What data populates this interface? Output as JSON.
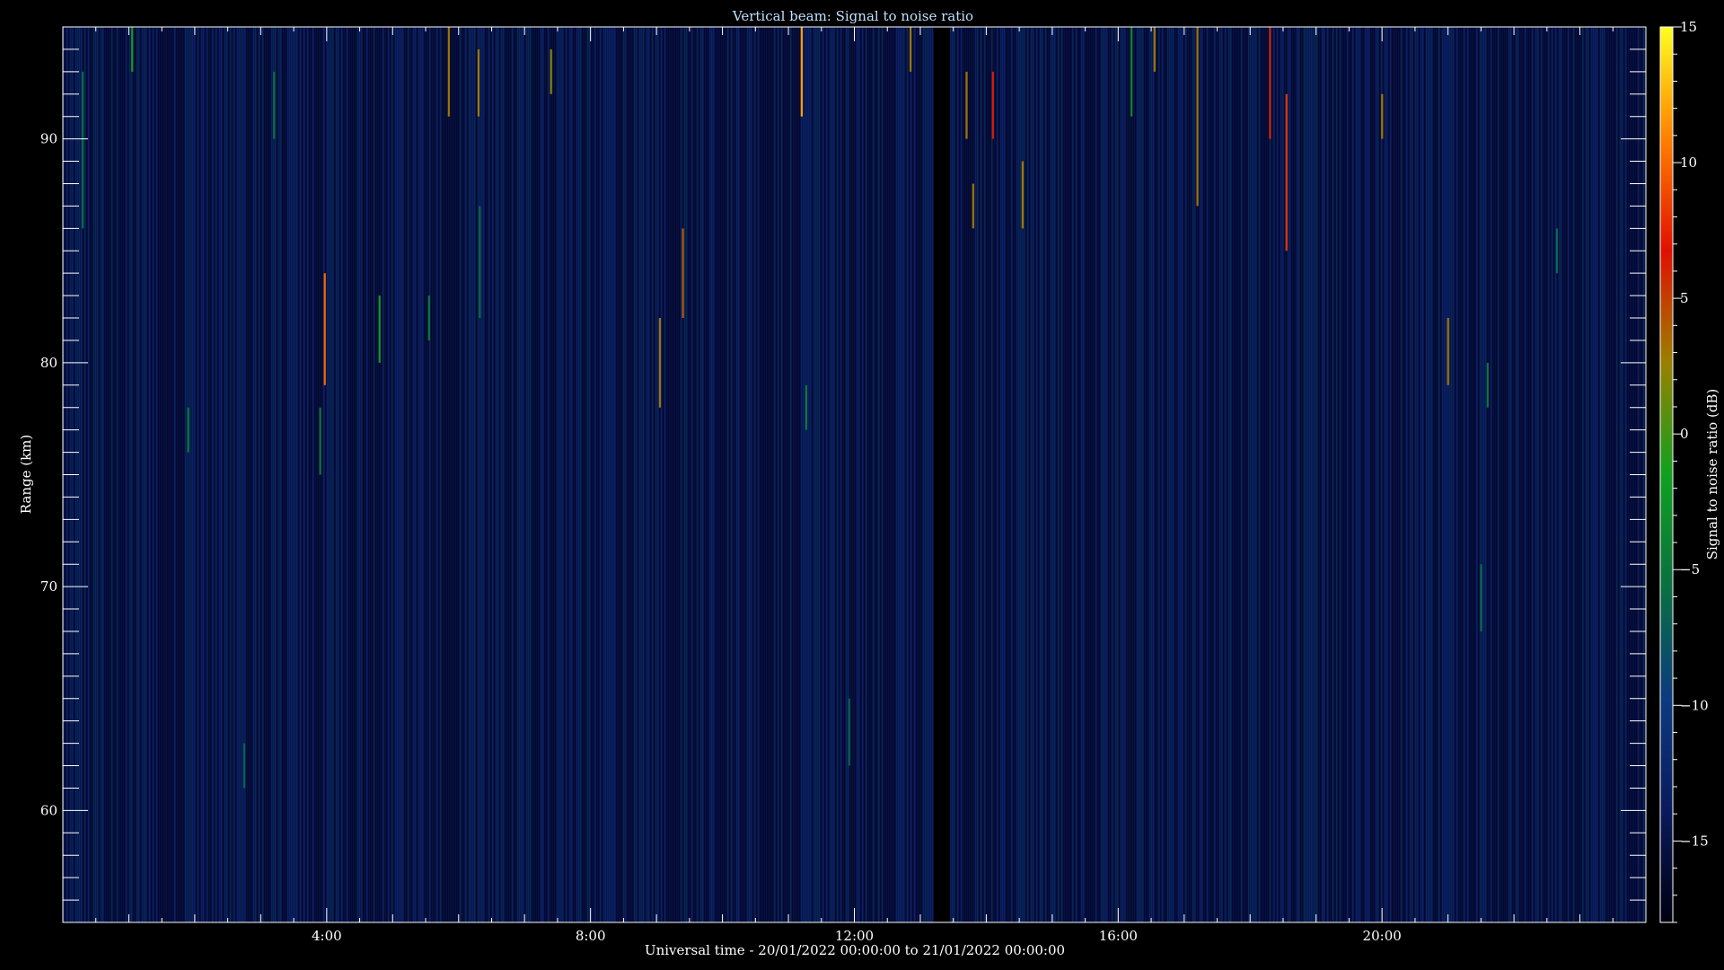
{
  "chart_data": {
    "type": "heatmap",
    "title": "Vertical beam: Signal to noise ratio",
    "xlabel": "Universal time - 20/01/2022 00:00:00 to 21/01/2022 00:00:00",
    "ylabel": "Range (km)",
    "colorbar_label": "Signal to noise ratio (dB)",
    "xlim": [
      0,
      24
    ],
    "ylim": [
      55,
      95
    ],
    "x_ticks": [
      {
        "value": 4,
        "label": "4:00"
      },
      {
        "value": 8,
        "label": "8:00"
      },
      {
        "value": 12,
        "label": "12:00"
      },
      {
        "value": 16,
        "label": "16:00"
      },
      {
        "value": 20,
        "label": "20:00"
      }
    ],
    "y_ticks": [
      {
        "value": 60,
        "label": "60"
      },
      {
        "value": 70,
        "label": "70"
      },
      {
        "value": 80,
        "label": "80"
      },
      {
        "value": 90,
        "label": "90"
      }
    ],
    "colorbar_range": [
      -18,
      15
    ],
    "colorbar_ticks": [
      {
        "value": 15,
        "label": "15"
      },
      {
        "value": 10,
        "label": "10"
      },
      {
        "value": 5,
        "label": "5"
      },
      {
        "value": 0,
        "label": "0"
      },
      {
        "value": -5,
        "label": "−5"
      },
      {
        "value": -10,
        "label": "−10"
      },
      {
        "value": -15,
        "label": "−15"
      }
    ],
    "colormap": [
      "#000010",
      "#0a1a5c",
      "#0d3a80",
      "#0a7040",
      "#10a020",
      "#9a8000",
      "#e01000",
      "#ff8000",
      "#ffff20"
    ],
    "background_level_db": -15,
    "data_gap": [
      13.2,
      13.45
    ],
    "features": [
      {
        "x": 0.3,
        "y": [
          86,
          93
        ],
        "db": -6
      },
      {
        "x": 1.05,
        "y": [
          93,
          95
        ],
        "db": -2
      },
      {
        "x": 1.9,
        "y": [
          76,
          78
        ],
        "db": -5
      },
      {
        "x": 2.75,
        "y": [
          61,
          63
        ],
        "db": -7
      },
      {
        "x": 3.2,
        "y": [
          90,
          93
        ],
        "db": -6
      },
      {
        "x": 3.9,
        "y": [
          75,
          78
        ],
        "db": -5
      },
      {
        "x": 3.97,
        "y": [
          79,
          84
        ],
        "db": 10
      },
      {
        "x": 4.8,
        "y": [
          80,
          83
        ],
        "db": -2
      },
      {
        "x": 5.55,
        "y": [
          81,
          83
        ],
        "db": -5
      },
      {
        "x": 5.85,
        "y": [
          91,
          95
        ],
        "db": 3
      },
      {
        "x": 6.3,
        "y": [
          91,
          94
        ],
        "db": 3
      },
      {
        "x": 6.32,
        "y": [
          82,
          87
        ],
        "db": -6
      },
      {
        "x": 7.4,
        "y": [
          92,
          94
        ],
        "db": 2
      },
      {
        "x": 9.05,
        "y": [
          78,
          82
        ],
        "db": 3
      },
      {
        "x": 9.4,
        "y": [
          82,
          86
        ],
        "db": 4
      },
      {
        "x": 11.2,
        "y": [
          91,
          95
        ],
        "db": 12
      },
      {
        "x": 11.27,
        "y": [
          77,
          79
        ],
        "db": -5
      },
      {
        "x": 11.92,
        "y": [
          62,
          65
        ],
        "db": -7
      },
      {
        "x": 12.85,
        "y": [
          93,
          95
        ],
        "db": 3
      },
      {
        "x": 13.7,
        "y": [
          90,
          93
        ],
        "db": 3
      },
      {
        "x": 13.8,
        "y": [
          86,
          88
        ],
        "db": 3
      },
      {
        "x": 14.1,
        "y": [
          90,
          93
        ],
        "db": 7
      },
      {
        "x": 14.55,
        "y": [
          86,
          89
        ],
        "db": 3
      },
      {
        "x": 16.2,
        "y": [
          91,
          95
        ],
        "db": -4
      },
      {
        "x": 16.55,
        "y": [
          93,
          95
        ],
        "db": 3
      },
      {
        "x": 17.2,
        "y": [
          87,
          95
        ],
        "db": 3
      },
      {
        "x": 18.3,
        "y": [
          90,
          95
        ],
        "db": 6
      },
      {
        "x": 18.55,
        "y": [
          85,
          92
        ],
        "db": 8
      },
      {
        "x": 20.0,
        "y": [
          90,
          92
        ],
        "db": 3
      },
      {
        "x": 21.0,
        "y": [
          79,
          82
        ],
        "db": 3
      },
      {
        "x": 21.5,
        "y": [
          68,
          71
        ],
        "db": -6
      },
      {
        "x": 21.6,
        "y": [
          78,
          80
        ],
        "db": -5
      },
      {
        "x": 22.65,
        "y": [
          84,
          86
        ],
        "db": -6
      }
    ]
  }
}
